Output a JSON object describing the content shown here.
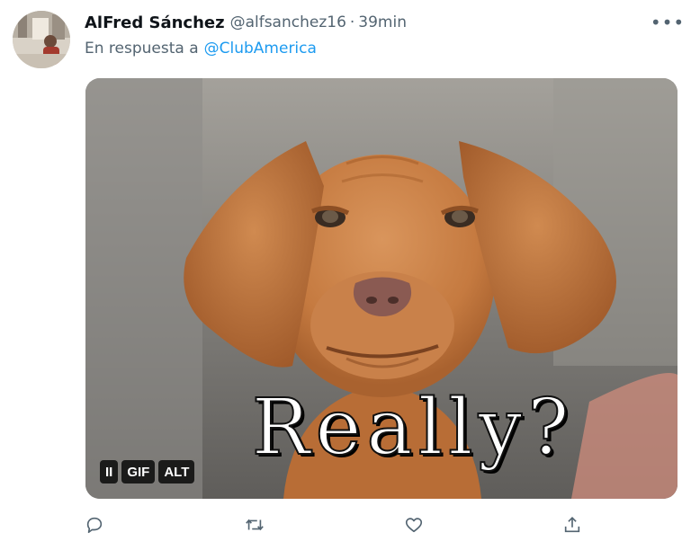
{
  "tweet": {
    "author": {
      "display_name": "AlFred Sánchez",
      "handle": "@alfsanchez16",
      "separator": "·",
      "time": "39min"
    },
    "reply": {
      "prefix": "En respuesta a",
      "mention": "@ClubAmerica"
    },
    "more_label": "•••",
    "media": {
      "type": "gif",
      "caption": "Really?",
      "badges": {
        "pause": "II",
        "gif": "GIF",
        "alt": "ALT"
      }
    },
    "actions": [
      "reply-icon",
      "retweet-icon",
      "like-icon",
      "share-icon"
    ]
  },
  "colors": {
    "link": "#1d9bf0",
    "secondary_text": "#536471",
    "icon": "#536471"
  }
}
